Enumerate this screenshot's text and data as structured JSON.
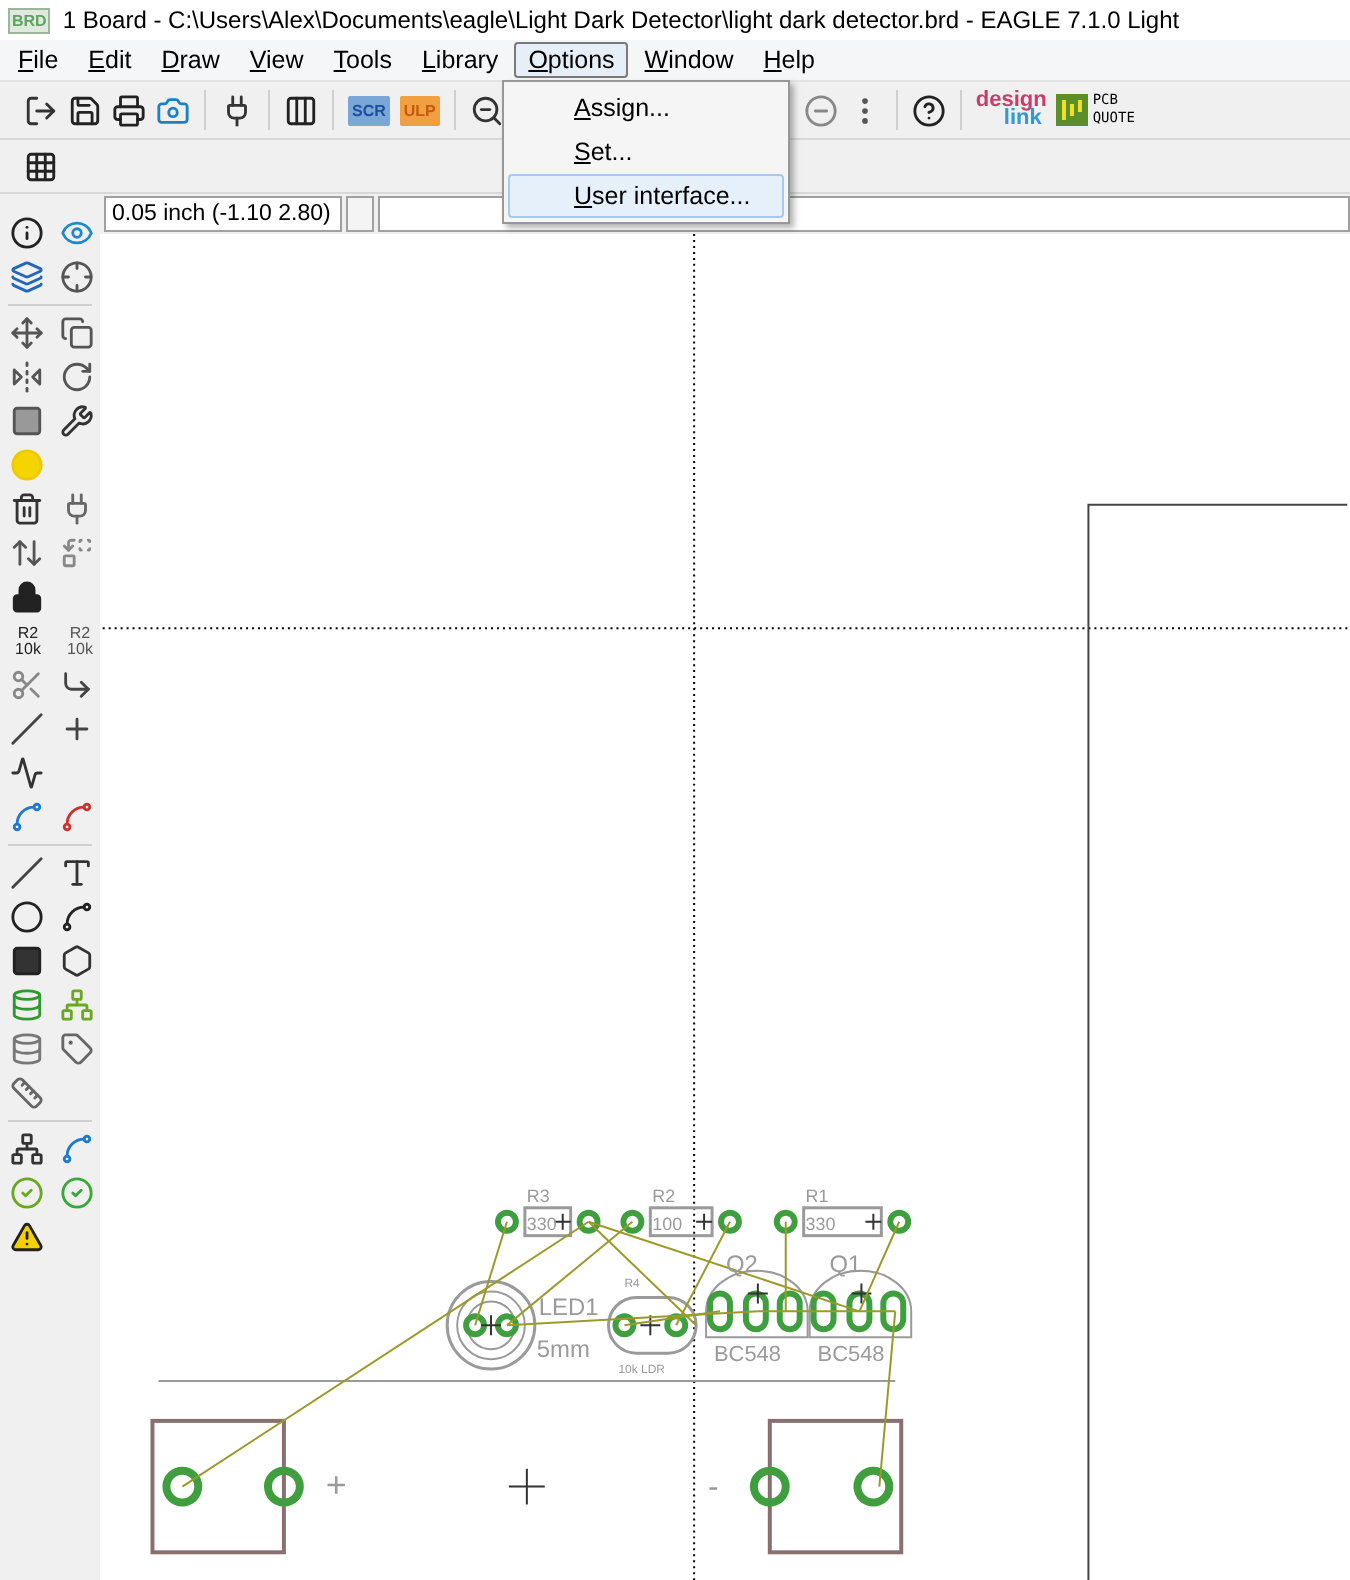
{
  "window": {
    "icon_text": "BRD",
    "title": "1 Board - C:\\Users\\Alex\\Documents\\eagle\\Light Dark Detector\\light dark detector.brd - EAGLE 7.1.0 Light"
  },
  "menu": [
    {
      "label": "File",
      "selected": false
    },
    {
      "label": "Edit",
      "selected": false
    },
    {
      "label": "Draw",
      "selected": false
    },
    {
      "label": "View",
      "selected": false
    },
    {
      "label": "Tools",
      "selected": false
    },
    {
      "label": "Library",
      "selected": false
    },
    {
      "label": "Options",
      "selected": true
    },
    {
      "label": "Window",
      "selected": false
    },
    {
      "label": "Help",
      "selected": false
    }
  ],
  "options_menu": [
    {
      "label": "Assign...",
      "selected": false
    },
    {
      "label": "Set...",
      "selected": false
    },
    {
      "label": "User interface...",
      "selected": true
    }
  ],
  "toolbar": {
    "scr": "SCR",
    "ulp": "ULP",
    "designlink": [
      "design",
      "link"
    ],
    "pcb_quote": [
      "PCB",
      "QUOTE"
    ]
  },
  "palette": {
    "name_tool": [
      "R2",
      "10k"
    ],
    "value_tool": [
      "R2",
      "10k"
    ]
  },
  "coordinates": "0.05 inch (-1.10 2.80)",
  "board": {
    "parts": [
      {
        "kind": "resistor",
        "name": "R3",
        "value": "330"
      },
      {
        "kind": "resistor",
        "name": "R2",
        "value": "100"
      },
      {
        "kind": "resistor",
        "name": "R1",
        "value": "330"
      },
      {
        "kind": "led",
        "name": "LED1",
        "value": "5mm"
      },
      {
        "kind": "ldr",
        "name": "R4",
        "value": "10k LDR"
      },
      {
        "kind": "transistor",
        "name": "Q2",
        "value": "BC548"
      },
      {
        "kind": "transistor",
        "name": "Q1",
        "value": "BC548"
      },
      {
        "kind": "terminal",
        "name": "+"
      },
      {
        "kind": "terminal",
        "name": "-"
      }
    ]
  }
}
